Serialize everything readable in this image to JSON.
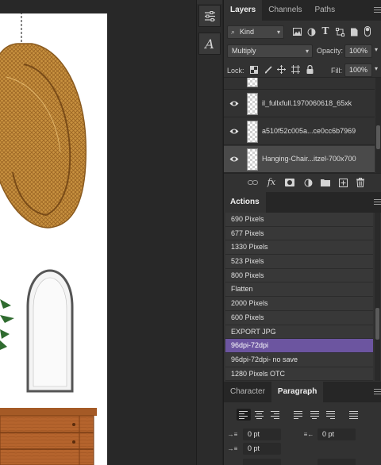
{
  "layers_panel": {
    "tabs": [
      "Layers",
      "Channels",
      "Paths"
    ],
    "active_tab": "Layers",
    "filter_kind": "Kind",
    "blend_mode": "Multiply",
    "opacity_label": "Opacity:",
    "opacity_value": "100%",
    "lock_label": "Lock:",
    "fill_label": "Fill:",
    "fill_value": "100%",
    "layers": [
      {
        "name": "",
        "visible": false
      },
      {
        "name": "il_fullxfull.1970060618_65xk",
        "visible": true
      },
      {
        "name": "a510f52c005a...ce0cc6b7969",
        "visible": true
      },
      {
        "name": "Hanging-Chair...itzel-700x700",
        "visible": true,
        "selected": true
      }
    ],
    "footer_icons": [
      "link-icon",
      "fx-icon",
      "mask-icon",
      "adjustment-icon",
      "folder-icon",
      "new-layer-icon",
      "trash-icon"
    ],
    "fx_label": "fx"
  },
  "actions_panel": {
    "tab": "Actions",
    "items": [
      {
        "label": "690 Pixels"
      },
      {
        "label": "677 Pixels"
      },
      {
        "label": "1330 Pixels"
      },
      {
        "label": "523 Pixels"
      },
      {
        "label": "800 Pixels"
      },
      {
        "label": "Flatten"
      },
      {
        "label": "2000 Pixels"
      },
      {
        "label": "600 Pixels"
      },
      {
        "label": "EXPORT JPG"
      },
      {
        "label": "96dpi-72dpi",
        "selected": true
      },
      {
        "label": "96dpi-72dpi- no save"
      },
      {
        "label": "1280 Pixels OTC"
      }
    ],
    "selected_color": "#6c55a0"
  },
  "paragraph_panel": {
    "tabs": [
      "Character",
      "Paragraph"
    ],
    "active_tab": "Paragraph",
    "indent_left": "0 pt",
    "indent_right": "0 pt",
    "indent_first": "0 pt"
  },
  "toolstrip": {
    "icons": [
      "adjustments-icon",
      "glyphs-icon"
    ],
    "glyph_char": "A"
  }
}
